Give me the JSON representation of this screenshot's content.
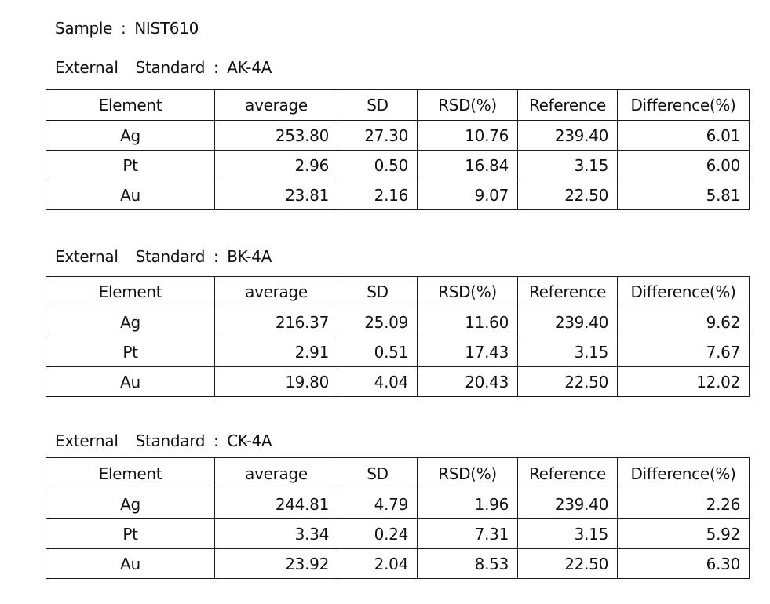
{
  "sample": {
    "label": "Sample",
    "colon": ":",
    "value": "NIST610"
  },
  "columns": [
    "Element",
    "average",
    "SD",
    "RSD(%)",
    "Reference",
    "Difference(%)"
  ],
  "sections": [
    {
      "label_1": "External",
      "label_2": "Standard",
      "colon": ":",
      "standard": "AK-4A",
      "rows": [
        {
          "element": "Ag",
          "average": "253.80",
          "sd": "27.30",
          "rsd": "10.76",
          "reference": "239.40",
          "difference": "6.01"
        },
        {
          "element": "Pt",
          "average": "2.96",
          "sd": "0.50",
          "rsd": "16.84",
          "reference": "3.15",
          "difference": "6.00"
        },
        {
          "element": "Au",
          "average": "23.81",
          "sd": "2.16",
          "rsd": "9.07",
          "reference": "22.50",
          "difference": "5.81"
        }
      ]
    },
    {
      "label_1": "External",
      "label_2": "Standard",
      "colon": ":",
      "standard": "BK-4A",
      "rows": [
        {
          "element": "Ag",
          "average": "216.37",
          "sd": "25.09",
          "rsd": "11.60",
          "reference": "239.40",
          "difference": "9.62"
        },
        {
          "element": "Pt",
          "average": "2.91",
          "sd": "0.51",
          "rsd": "17.43",
          "reference": "3.15",
          "difference": "7.67"
        },
        {
          "element": "Au",
          "average": "19.80",
          "sd": "4.04",
          "rsd": "20.43",
          "reference": "22.50",
          "difference": "12.02"
        }
      ]
    },
    {
      "label_1": "External",
      "label_2": "Standard",
      "colon": ":",
      "standard": "CK-4A",
      "rows": [
        {
          "element": "Ag",
          "average": "244.81",
          "sd": "4.79",
          "rsd": "1.96",
          "reference": "239.40",
          "difference": "2.26"
        },
        {
          "element": "Pt",
          "average": "3.34",
          "sd": "0.24",
          "rsd": "7.31",
          "reference": "3.15",
          "difference": "5.92"
        },
        {
          "element": "Au",
          "average": "23.92",
          "sd": "2.04",
          "rsd": "8.53",
          "reference": "22.50",
          "difference": "6.30"
        }
      ]
    }
  ]
}
